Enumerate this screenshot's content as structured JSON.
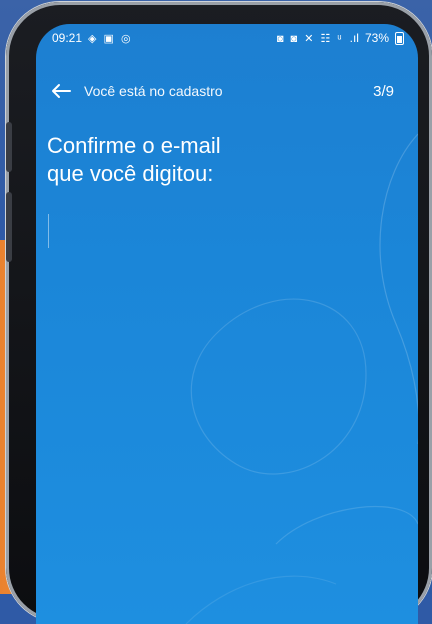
{
  "status_bar": {
    "time": "09:21",
    "left_icons": "◈ ▣ ◎",
    "right_icons": "◙ ◙ ✕ ☷ ᵘ",
    "signal": ".ıl",
    "battery": "73%"
  },
  "appbar": {
    "title": "Você está no cadastro",
    "step": "3/9"
  },
  "main": {
    "heading_line1": "Confirme o e-mail",
    "heading_line2": "que você digitou:",
    "email_value": ""
  },
  "colors": {
    "screen_top": "#1d7fd1",
    "screen_bottom": "#1e8fe0",
    "accent_orange": "#f08a33"
  }
}
